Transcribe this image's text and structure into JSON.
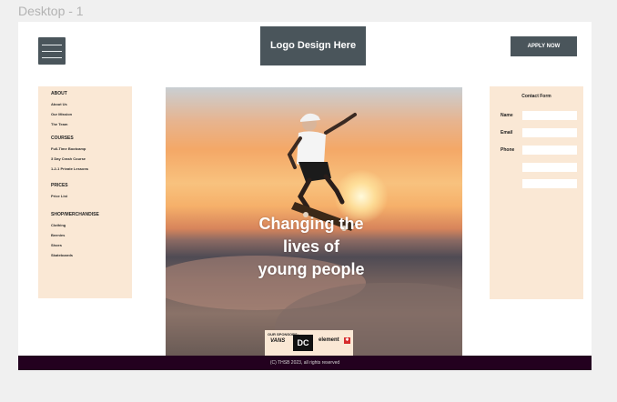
{
  "canvas": {
    "frame_label": "Desktop - 1"
  },
  "header": {
    "logo_text": "Logo Design Here",
    "apply_label": "APPLY NOW"
  },
  "side_menu": {
    "sections": [
      {
        "heading": "ABOUT",
        "items": [
          "About Us",
          "Our Mission",
          "The Team"
        ]
      },
      {
        "heading": "COURSES",
        "items": [
          "Full-Time Bootcamp",
          "3 Day Crash Course",
          "1-2-1 Private Lessons"
        ]
      },
      {
        "heading": "PRICES",
        "items": [
          "Price List"
        ]
      },
      {
        "heading": "SHOP/MERCHANDISE",
        "items": [
          "Clothing",
          "Beenies",
          "Shoes",
          "Skateboards"
        ]
      }
    ]
  },
  "hero": {
    "headline": "Changing the lives of young people",
    "sponsors": {
      "label": "OUR SPONSORS:",
      "brands": [
        "VANS",
        "DC",
        "element"
      ]
    }
  },
  "contact_form": {
    "title": "Contact Form",
    "fields": [
      {
        "label": "Name",
        "value": ""
      },
      {
        "label": "Email",
        "value": ""
      },
      {
        "label": "Phone",
        "value": ""
      },
      {
        "label": "",
        "value": ""
      },
      {
        "label": "",
        "value": ""
      }
    ]
  },
  "footer": {
    "text": "(C) THSB 2023, all rights reserved"
  },
  "colors": {
    "header_block": "#4a555b",
    "panel_bg": "#fae8d5",
    "footer_bg": "#23011f"
  }
}
